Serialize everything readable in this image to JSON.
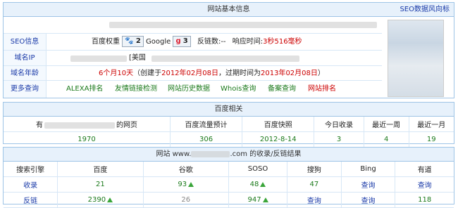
{
  "info": {
    "title": "网站基本信息",
    "right_link": "SEO数据风向标",
    "seo": {
      "label": "SEO信息",
      "baidu_weight_label": "百度权重",
      "baidu_weight_value": "2",
      "google_label": "Google",
      "google_value": "3",
      "backlinks_label": "反链数:",
      "backlinks_value": "--",
      "response_label": "响应时间:",
      "response_value": "3秒516毫秒"
    },
    "domain_ip": {
      "label": "域名IP",
      "location": "[美国"
    },
    "domain_age": {
      "label": "域名年龄",
      "age": "6个月10天",
      "created_prefix": "（创建于",
      "created": "2012年02月08日",
      "expire_prefix": "，过期时间为",
      "expire": "2013年02月08日",
      "suffix": "）"
    },
    "more": {
      "label": "更多查询",
      "links": [
        "ALEXA排名",
        "友情链接检测",
        "网站历史数据",
        "Whois查询",
        "备案查询",
        "网站排名"
      ]
    }
  },
  "baidu": {
    "title": "百度相关",
    "headers": [
      "有",
      "百度流量预计",
      "百度快照",
      "今日收录",
      "最近一周",
      "最近一月"
    ],
    "first_header_suffix": "的网页",
    "values": [
      "1970",
      "306",
      "2012-8-14",
      "3",
      "4",
      "19"
    ]
  },
  "index": {
    "title_prefix": "网站 www.",
    "title_suffix": ".com 的收录/反链结果",
    "headers": [
      "搜索引擎",
      "百度",
      "谷歌",
      "SOSO",
      "搜狗",
      "Bing",
      "有道"
    ],
    "rows": [
      {
        "label": "收录",
        "cells": [
          "21",
          "93",
          "48",
          "47",
          "查询",
          "查询"
        ]
      },
      {
        "label": "反链",
        "cells": [
          "2390",
          "26",
          "947",
          "查询",
          "查询",
          "118"
        ]
      }
    ]
  }
}
